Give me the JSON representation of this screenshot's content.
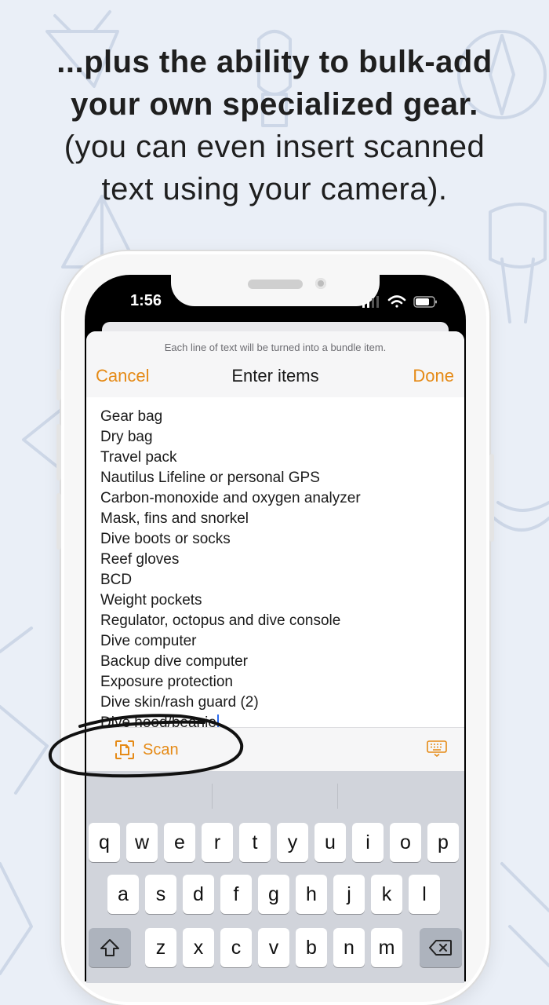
{
  "headline": {
    "line1": "...plus the ability to bulk-add",
    "line2": "your own specialized gear.",
    "line3": "(you can even insert scanned",
    "line4": "text using your camera)."
  },
  "status_bar": {
    "time": "1:56"
  },
  "sheet": {
    "hint": "Each line of text will be turned into a bundle item.",
    "cancel": "Cancel",
    "title": "Enter items",
    "done": "Done"
  },
  "items": [
    "Gear bag",
    "Dry bag",
    "Travel pack",
    "Nautilus Lifeline or personal GPS",
    "Carbon-monoxide and oxygen analyzer",
    "Mask, fins and snorkel",
    "Dive boots or socks",
    "Reef gloves",
    "BCD",
    "Weight pockets",
    "Regulator, octopus and dive console",
    "Dive computer",
    "Backup dive computer",
    "Exposure protection",
    "Dive skin/rash guard (2)",
    "Dive hood/beanie"
  ],
  "toolbar": {
    "scan_label": "Scan"
  },
  "keyboard": {
    "row1": [
      "q",
      "w",
      "e",
      "r",
      "t",
      "y",
      "u",
      "i",
      "o",
      "p"
    ],
    "row2": [
      "a",
      "s",
      "d",
      "f",
      "g",
      "h",
      "j",
      "k",
      "l"
    ],
    "row3": [
      "z",
      "x",
      "c",
      "v",
      "b",
      "n",
      "m"
    ]
  },
  "colors": {
    "accent": "#E58A16",
    "background": "#EAEFF7",
    "caret": "#2B6CF0"
  }
}
